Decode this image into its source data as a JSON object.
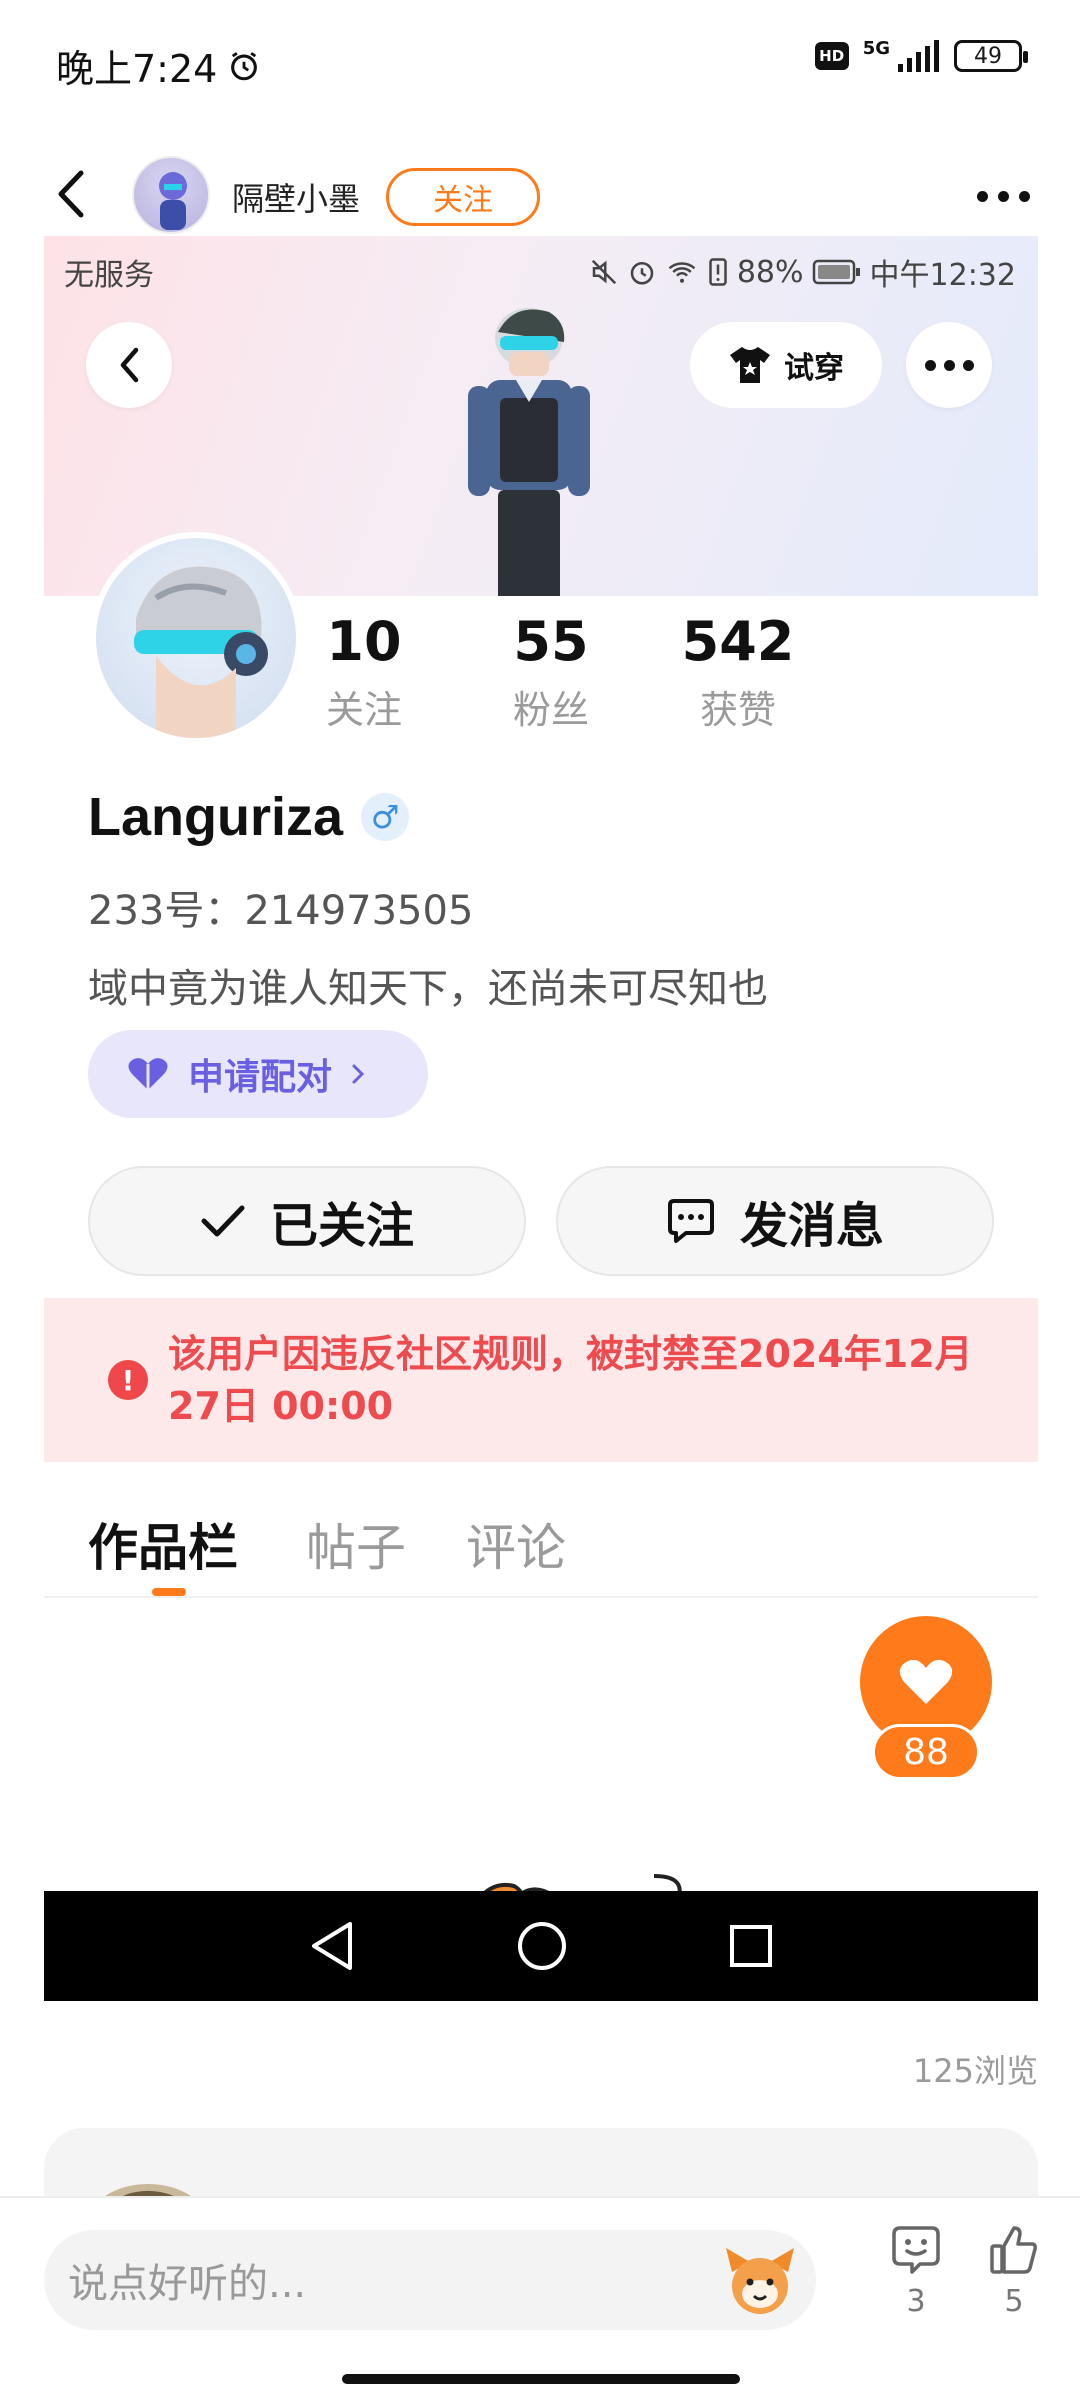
{
  "status_bar": {
    "time": "晚上7:24",
    "hd": "HD",
    "network": "5G",
    "battery": "49"
  },
  "header": {
    "username": "隔壁小墨",
    "follow_label": "关注"
  },
  "inner_status": {
    "service": "无服务",
    "battery": "88%",
    "time": "中午12:32"
  },
  "banner": {
    "try_on_label": "试穿"
  },
  "profile": {
    "stats": [
      {
        "value": "10",
        "label": "关注"
      },
      {
        "value": "55",
        "label": "粉丝"
      },
      {
        "value": "542",
        "label": "获赞"
      }
    ],
    "username": "Languriza",
    "gender_symbol": "♂",
    "uid": "233号：214973505",
    "bio": "域中竟为谁人知天下，还尚未可尽知也",
    "pair_label": "申请配对"
  },
  "actions": {
    "followed_label": "已关注",
    "message_label": "发消息"
  },
  "ban_notice": {
    "text": "该用户因违反社区规则，被封禁至2024年12月27日 00:00"
  },
  "tabs": [
    {
      "label": "作品栏"
    },
    {
      "label": "帖子"
    },
    {
      "label": "评论"
    }
  ],
  "like_button": {
    "count": "88"
  },
  "post": {
    "views": "125浏览"
  },
  "bottom_bar": {
    "input_placeholder": "说点好听的...",
    "comment_count": "3",
    "like_count": "5"
  },
  "colors": {
    "accent": "#ff7a1a",
    "danger": "#ee4b4e",
    "pair": "#6a5fe0"
  }
}
